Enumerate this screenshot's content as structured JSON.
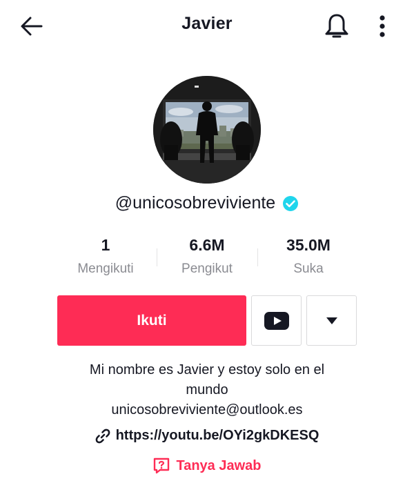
{
  "header": {
    "title": "Javier",
    "back_icon": "arrow-left-icon",
    "bell_icon": "bell-icon",
    "more_icon": "more-vertical-icon"
  },
  "profile": {
    "username": "@unicosobreviviente",
    "verified": true,
    "verified_color": "#20d5ec"
  },
  "stats": [
    {
      "value": "1",
      "label": "Mengikuti"
    },
    {
      "value": "6.6M",
      "label": "Pengikut"
    },
    {
      "value": "35.0M",
      "label": "Suka"
    }
  ],
  "actions": {
    "follow_label": "Ikuti",
    "follow_color": "#fe2c55",
    "youtube_icon": "youtube-icon",
    "dropdown_icon": "caret-down-icon"
  },
  "bio": {
    "lines": [
      "Mi nombre es Javier y estoy solo en el",
      "mundo",
      "unicosobreviviente@outlook.es"
    ]
  },
  "link": {
    "icon": "link-icon",
    "text": "https://youtu.be/OYi2gkDKESQ"
  },
  "qa": {
    "icon": "question-box-icon",
    "text": "Tanya Jawab",
    "color": "#fe2c55"
  }
}
